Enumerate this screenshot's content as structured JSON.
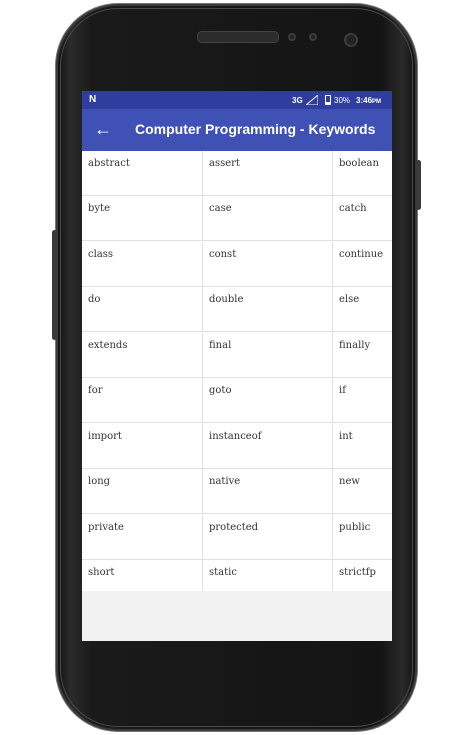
{
  "status_bar": {
    "network": "3G",
    "battery": "30%",
    "time": "3:46",
    "time_suffix": "PM",
    "notification_icon": "n-icon"
  },
  "app_bar": {
    "back_icon": "arrow-back-icon",
    "back_glyph": "←",
    "title": "Computer Programming - Keywords"
  },
  "keywords": [
    [
      "abstract",
      "assert",
      "boolean"
    ],
    [
      "byte",
      "case",
      "catch"
    ],
    [
      "class",
      "const",
      "continue"
    ],
    [
      "do",
      "double",
      "else"
    ],
    [
      "extends",
      "final",
      "finally"
    ],
    [
      "for",
      "goto",
      "if"
    ],
    [
      "import",
      "instanceof",
      "int"
    ],
    [
      "long",
      "native",
      "new"
    ],
    [
      "private",
      "protected",
      "public"
    ],
    [
      "short",
      "static",
      "strictfp"
    ]
  ],
  "colors": {
    "status_bar": "#2f3e9e",
    "app_bar": "#3f51b5",
    "phone_body": "#1a1a1a"
  }
}
